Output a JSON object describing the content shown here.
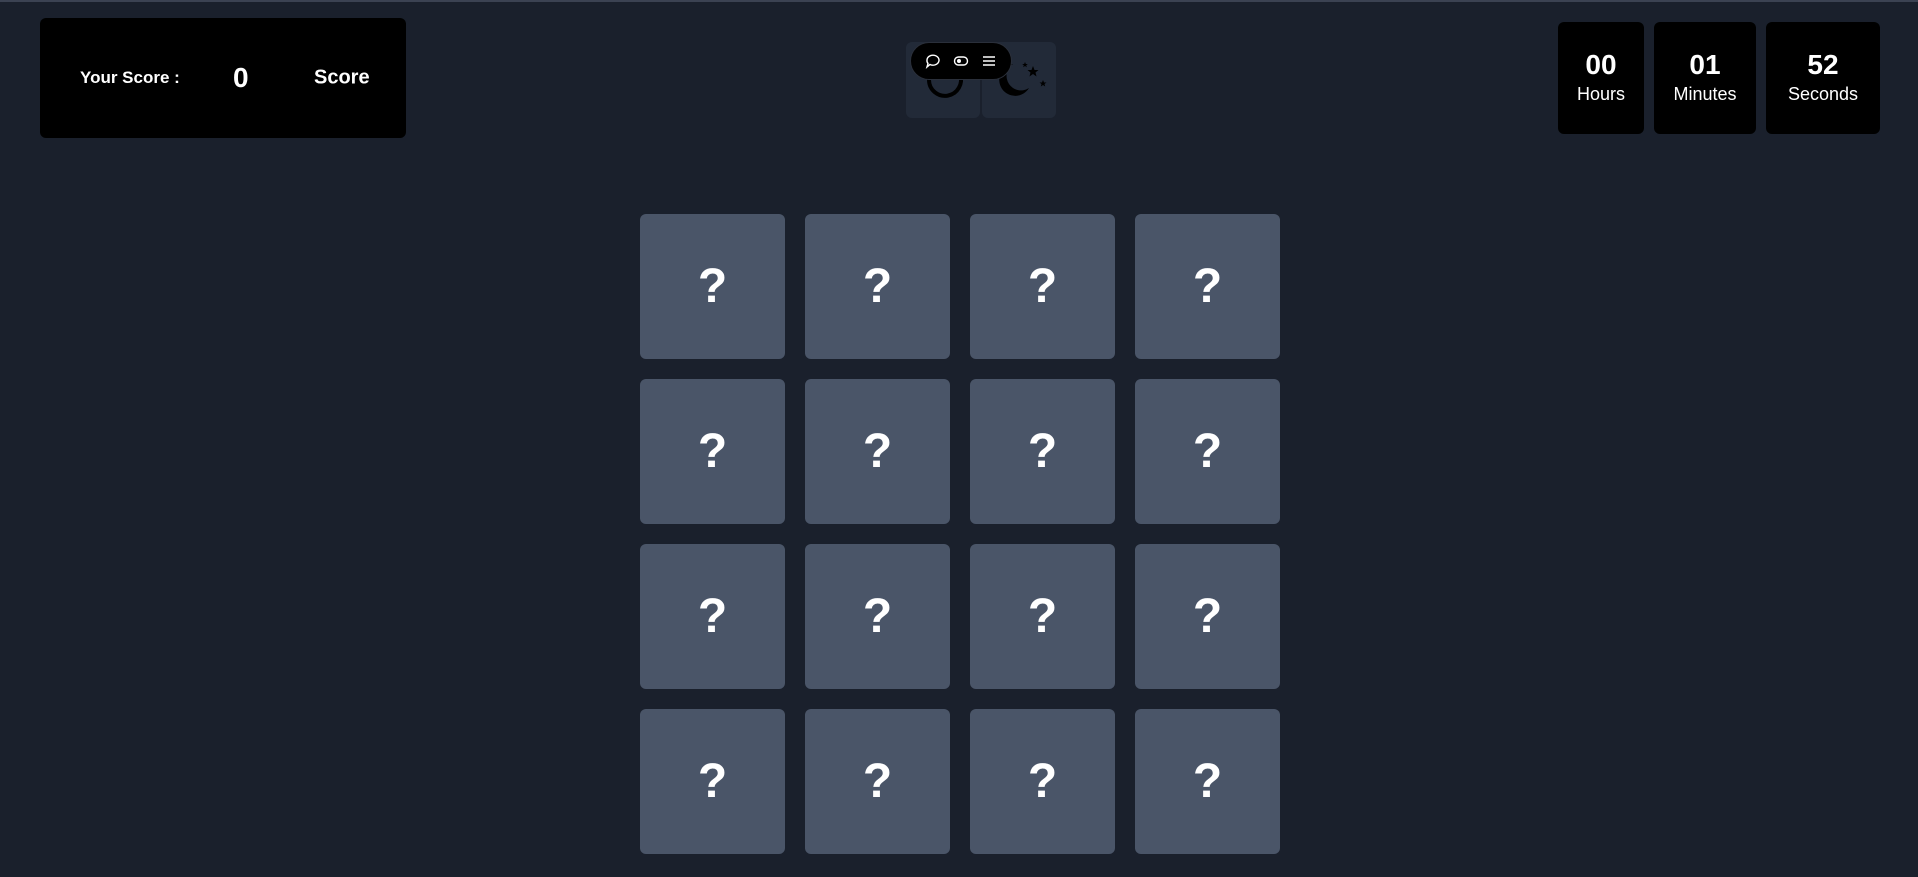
{
  "score": {
    "label": "Your Score :",
    "value": "0",
    "unit": "Score"
  },
  "tools": {
    "restart_icon": "restart-icon",
    "theme_icon": "moon-stars-icon",
    "floating_bar": [
      "chat-icon",
      "toggle-icon",
      "menu-icon"
    ]
  },
  "timer": {
    "hours": {
      "value": "00",
      "label": "Hours"
    },
    "minutes": {
      "value": "01",
      "label": "Minutes"
    },
    "seconds": {
      "value": "52",
      "label": "Seconds"
    }
  },
  "board": {
    "cards": [
      "?",
      "?",
      "?",
      "?",
      "?",
      "?",
      "?",
      "?",
      "?",
      "?",
      "?",
      "?",
      "?",
      "?",
      "?",
      "?"
    ]
  },
  "colors": {
    "background": "#1a202c",
    "panel": "#000000",
    "card": "#4a5568"
  }
}
